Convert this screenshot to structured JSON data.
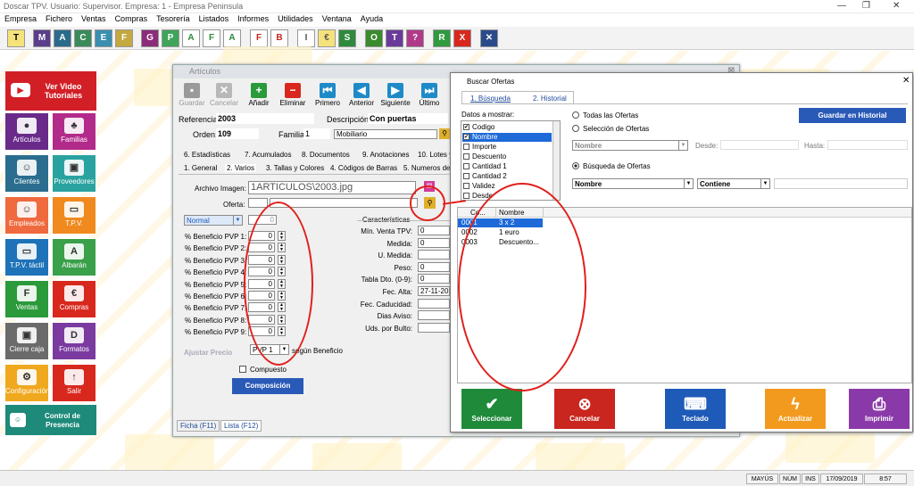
{
  "window": {
    "title": "Doscar TPV. Usuario: Supervisor. Empresa: 1 - Empresa Peninsula"
  },
  "menu": [
    "Empresa",
    "Fichero",
    "Ventas",
    "Compras",
    "Tesorería",
    "Listados",
    "Informes",
    "Utilidades",
    "Ventana",
    "Ayuda"
  ],
  "toolbar_icons": [
    "T",
    "M",
    "A",
    "C",
    "E",
    "F",
    "G",
    "P",
    "A",
    "F",
    "A",
    "F",
    "B",
    "I",
    "€",
    "S",
    "O",
    "T",
    "?",
    "R",
    "X"
  ],
  "left_menu": {
    "video": "Ver Video Tutoriales",
    "tiles": [
      "Artículos",
      "Familias",
      "Clientes",
      "Proveedores",
      "Empleados",
      "T.P.V.",
      "T.P.V. táctil",
      "Albarán",
      "Ventas",
      "Compras",
      "Cierre caja",
      "Formatos",
      "Configuración",
      "Salir"
    ],
    "control": "Control de Presencia"
  },
  "articulos": {
    "title": "Artículos",
    "toolbar": [
      "Guardar",
      "Cancelar",
      "Añadir",
      "Eliminar",
      "Primero",
      "Anterior",
      "Siguiente",
      "Último"
    ],
    "referencia_label": "Referencia:",
    "referencia": "2003",
    "descripcion_label": "Descripción:",
    "descripcion": "Con puertas",
    "orden_label": "Orden:",
    "orden": "109",
    "familia_label": "Familia:",
    "familia": "1",
    "familia_nombre": "Mobiliario",
    "tabs_row1": [
      "6. Estadísticas",
      "7. Acumulados",
      "8. Documentos",
      "9. Anotaciones",
      "10. Lotes y"
    ],
    "tabs_row2": [
      "1. General",
      "2. Varios",
      "3. Tallas y Colores",
      "4. Códigos de Barras",
      "5. Numeros de"
    ],
    "archivo_label": "Archivo Imagen:",
    "archivo": "1ARTICULOS\\2003.jpg",
    "oferta_label": "Oferta:",
    "tarifa": "Normal",
    "tarifa_value": "0",
    "beneficios": [
      {
        "label": "% Beneficio PVP 1:",
        "value": "0"
      },
      {
        "label": "% Beneficio PVP 2:",
        "value": "0"
      },
      {
        "label": "% Beneficio PVP 3:",
        "value": "0"
      },
      {
        "label": "% Beneficio PVP 4:",
        "value": "0"
      },
      {
        "label": "% Beneficio PVP 5:",
        "value": "0"
      },
      {
        "label": "% Beneficio PVP 6:",
        "value": "0"
      },
      {
        "label": "% Beneficio PVP 7:",
        "value": "0"
      },
      {
        "label": "% Beneficio PVP 8:",
        "value": "0"
      },
      {
        "label": "% Beneficio PVP 9:",
        "value": "0"
      }
    ],
    "ajustar_label": "Ajustar Precio",
    "ajustar_select": "PVP 1",
    "segun": "según Beneficio",
    "compuesto": "Compuesto",
    "composicion": "Composición",
    "caracteristicas_title": "Características",
    "caracteristicas": [
      {
        "label": "Mín. Venta TPV:",
        "value": "0"
      },
      {
        "label": "Medida:",
        "value": "0"
      },
      {
        "label": "U. Medida:",
        "value": ""
      },
      {
        "label": "Peso:",
        "value": "0"
      },
      {
        "label": "Tabla Dto. (0-9):",
        "value": "0"
      },
      {
        "label": "Fec. Alta:",
        "value": "27-11-20"
      },
      {
        "label": "Fec. Caducidad:",
        "value": ""
      },
      {
        "label": "Dias Aviso:",
        "value": ""
      },
      {
        "label": "Uds. por Bulto:",
        "value": ""
      }
    ],
    "bottom_tabs": [
      "Ficha (F11)",
      "Lista (F12)"
    ]
  },
  "buscar": {
    "title": "Buscar Ofertas",
    "tabs": [
      "1. Búsqueda",
      "2. Historial"
    ],
    "datos_label": "Datos a mostrar:",
    "datos": [
      {
        "label": "Codigo",
        "checked": true
      },
      {
        "label": "Nombre",
        "checked": true
      },
      {
        "label": "Importe",
        "checked": false
      },
      {
        "label": "Descuento",
        "checked": false
      },
      {
        "label": "Cantidad 1",
        "checked": false
      },
      {
        "label": "Cantidad 2",
        "checked": false
      },
      {
        "label": "Validez",
        "checked": false
      },
      {
        "label": "Desde",
        "checked": false
      }
    ],
    "todas": "Todas las Ofertas",
    "guardar_historial": "Guardar en Historial",
    "seleccion": "Selección de Ofertas",
    "sel_campo": "Nombre",
    "desde": "Desde:",
    "hasta": "Hasta:",
    "busqueda": "Búsqueda de Ofertas",
    "campo": "Nombre",
    "condicion": "Contiene",
    "col_codigo": "Co...",
    "col_nombre": "Nombre",
    "rows": [
      {
        "codigo": "0001",
        "nombre": "3 x 2"
      },
      {
        "codigo": "0002",
        "nombre": "1 euro"
      },
      {
        "codigo": "0003",
        "nombre": "Descuento..."
      }
    ],
    "buttons": [
      "Seleccionar",
      "Cancelar",
      "Teclado",
      "Actualizar",
      "Imprimir"
    ]
  },
  "status": {
    "mayus": "MAYÚS",
    "num": "NÚM",
    "ins": "INS",
    "date": "17/09/2019",
    "time": "8:57"
  }
}
